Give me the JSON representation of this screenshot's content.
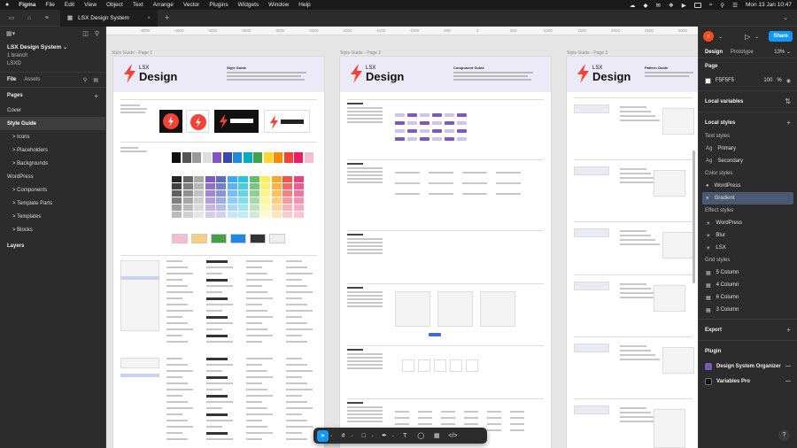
{
  "menubar": {
    "apple": "",
    "items": [
      "Figma",
      "File",
      "Edit",
      "View",
      "Object",
      "Text",
      "Arrange",
      "Vector",
      "Plugins",
      "Widgets",
      "Window",
      "Help"
    ],
    "clock": "Mon 13 Jan  10:47"
  },
  "tabbar": {
    "file_tab": "LSX Design System"
  },
  "left_panel": {
    "project_name": "LSX Design System",
    "branch": "1 branch",
    "team": "LSXD",
    "tab_file": "File",
    "tab_assets": "Assets",
    "pages_header": "Pages",
    "pages": [
      {
        "label": "Cover",
        "indent": false
      },
      {
        "label": "Style Guide",
        "indent": false,
        "selected": true
      },
      {
        "label": "> Icons",
        "indent": true
      },
      {
        "label": "> Placeholders",
        "indent": true
      },
      {
        "label": "> Backgrounds",
        "indent": true
      },
      {
        "label": "WordPress",
        "indent": false
      },
      {
        "label": "> Components",
        "indent": true
      },
      {
        "label": "> Template Parts",
        "indent": true
      },
      {
        "label": "> Templates",
        "indent": true
      },
      {
        "label": "> Blocks",
        "indent": true
      }
    ],
    "layers_header": "Layers"
  },
  "canvas": {
    "ruler_ticks": [
      "-5000",
      "-4500",
      "-4000",
      "-3500",
      "-3000",
      "-2500",
      "-2000",
      "-1500",
      "-1000",
      "-500",
      "0",
      "500",
      "1000",
      "1500",
      "2000",
      "2500",
      "3000"
    ],
    "frames": [
      {
        "label": "Style Guide - Page 1",
        "heading": "Style Guide",
        "logo_small": "LSX",
        "logo_big": "Design"
      },
      {
        "label": "Style Guide - Page 2",
        "heading": "Component Guide",
        "logo_small": "LSX",
        "logo_big": "Design"
      },
      {
        "label": "Style Guide - Page 3",
        "heading": "Pattern Guide",
        "logo_small": "LSX",
        "logo_big": "Design"
      }
    ],
    "accent_color": "#f44336",
    "purple_color": "#7e57c2",
    "hero_bg": "#eceaf6"
  },
  "toolbar": {
    "tools": [
      "move-tool",
      "frame-tool",
      "shape-tool",
      "pen-tool",
      "text-tool",
      "comment-tool",
      "actions-tool",
      "dev-mode-tool"
    ]
  },
  "right_panel": {
    "share_label": "Share",
    "tab_design": "Design",
    "tab_prototype": "Prototype",
    "zoom": "13%",
    "page_header": "Page",
    "page_color": "F5F5F5",
    "page_opacity": "100",
    "page_opacity_unit": "%",
    "local_variables": "Local variables",
    "local_styles": "Local styles",
    "text_styles_header": "Text styles",
    "text_styles": [
      "Primary",
      "Secondary"
    ],
    "color_styles_header": "Color styles",
    "color_styles": [
      "WordPress",
      "Gradient"
    ],
    "effect_styles_header": "Effect styles",
    "effect_styles": [
      "WordPress",
      "Blur",
      "LSX"
    ],
    "grid_styles_header": "Grid styles",
    "grid_styles": [
      "5 Column",
      "4 Column",
      "6 Column",
      "3 Column"
    ],
    "export_header": "Export",
    "plugin_header": "Plugin",
    "plugins": [
      "Design System Organizer",
      "Variables Pro"
    ],
    "help": "?"
  }
}
